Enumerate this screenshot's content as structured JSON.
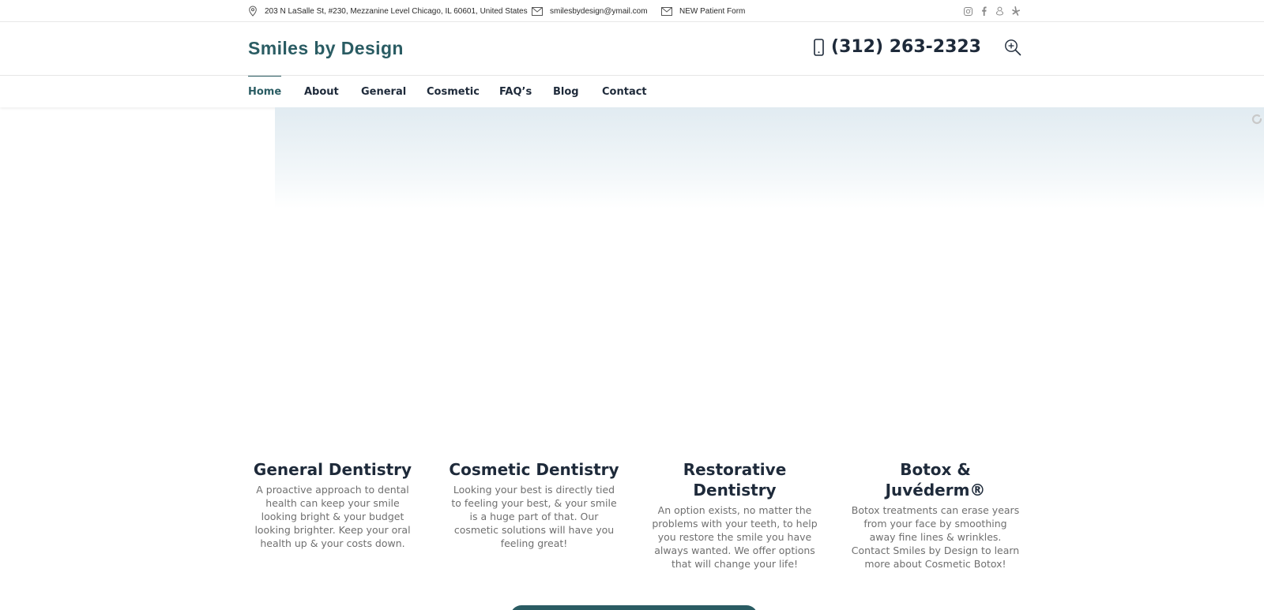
{
  "topbar": {
    "address": "203 N LaSalle St, #230, Mezzanine Level Chicago, IL 60601, United States",
    "email": "smilesbydesign@ymail.com",
    "form_link": "NEW Patient Form",
    "social_icons": [
      "instagram-icon",
      "facebook-icon",
      "google-plus-icon",
      "yelp-icon"
    ]
  },
  "header": {
    "logo": "Smiles by Design",
    "phone": "(312) 263-2323",
    "brand_color": "#2a5c63"
  },
  "nav": {
    "items": [
      "Home",
      "About",
      "General",
      "Cosmetic",
      "FAQ’s",
      "Blog",
      "Contact"
    ],
    "active": "Home"
  },
  "services": [
    {
      "title": "General Dentistry",
      "text": "A proactive approach to dental health can keep your smile looking bright & your budget looking brighter. Keep your oral health up & your costs down."
    },
    {
      "title": "Cosmetic Dentistry",
      "text": "Looking your best is directly tied to feeling your best, & your smile is a huge part of that. Our cosmetic solutions will have you feeling great!"
    },
    {
      "title": "Restorative Dentistry",
      "text": "An option exists, no matter the problems with your teeth, to help you restore the smile you have always wanted. We offer options that will change your life!"
    },
    {
      "title": "Botox & Juvéderm®",
      "text": "Botox treatments can erase years from your face by smoothing away fine lines & wrinkles. Contact Smiles by Design to learn more about Cosmetic Botox!"
    }
  ]
}
